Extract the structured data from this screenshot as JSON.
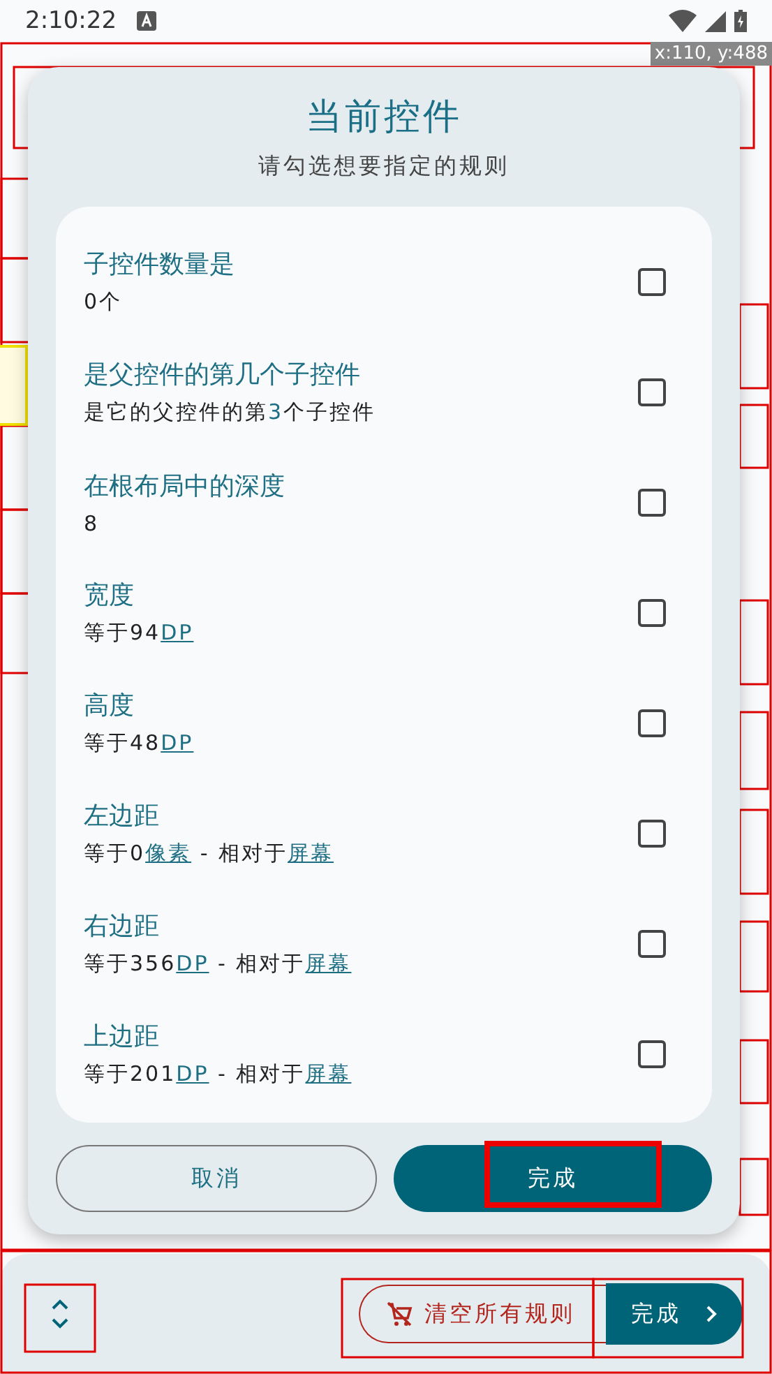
{
  "status_bar": {
    "time": "2:10:22"
  },
  "coordinate_badge": "x:110, y:488",
  "dialog": {
    "title": "当前控件",
    "subtitle": "请勾选想要指定的规则",
    "rules": [
      {
        "title": "子控件数量是",
        "description": [
          {
            "text": "0个",
            "kind": "plain"
          }
        ],
        "checked": false
      },
      {
        "title": "是父控件的第几个子控件",
        "description": [
          {
            "text": "是它的父控件的第",
            "kind": "plain"
          },
          {
            "text": "3",
            "kind": "accent"
          },
          {
            "text": "个子控件",
            "kind": "plain"
          }
        ],
        "checked": false
      },
      {
        "title": "在根布局中的深度",
        "description": [
          {
            "text": "8",
            "kind": "plain"
          }
        ],
        "checked": false
      },
      {
        "title": "宽度",
        "description": [
          {
            "text": "等于94",
            "kind": "plain"
          },
          {
            "text": "DP",
            "kind": "link"
          }
        ],
        "checked": false
      },
      {
        "title": "高度",
        "description": [
          {
            "text": "等于48",
            "kind": "plain"
          },
          {
            "text": "DP",
            "kind": "link"
          }
        ],
        "checked": false
      },
      {
        "title": "左边距",
        "description": [
          {
            "text": "等于0",
            "kind": "plain"
          },
          {
            "text": "像素",
            "kind": "link"
          },
          {
            "text": " - 相对于",
            "kind": "plain"
          },
          {
            "text": "屏幕",
            "kind": "link"
          }
        ],
        "checked": false
      },
      {
        "title": "右边距",
        "description": [
          {
            "text": "等于356",
            "kind": "plain"
          },
          {
            "text": "DP",
            "kind": "link"
          },
          {
            "text": " - 相对于",
            "kind": "plain"
          },
          {
            "text": "屏幕",
            "kind": "link"
          }
        ],
        "checked": false
      },
      {
        "title": "上边距",
        "description": [
          {
            "text": "等于201",
            "kind": "plain"
          },
          {
            "text": "DP",
            "kind": "link"
          },
          {
            "text": " - 相对于",
            "kind": "plain"
          },
          {
            "text": "屏幕",
            "kind": "link"
          }
        ],
        "checked": false
      }
    ],
    "buttons": [
      {
        "label": "取消",
        "kind": "outlined"
      },
      {
        "label": "完成",
        "kind": "filled"
      }
    ]
  },
  "bottom_bar": {
    "clear_button": "清空所有规则",
    "done_button": "完成"
  }
}
